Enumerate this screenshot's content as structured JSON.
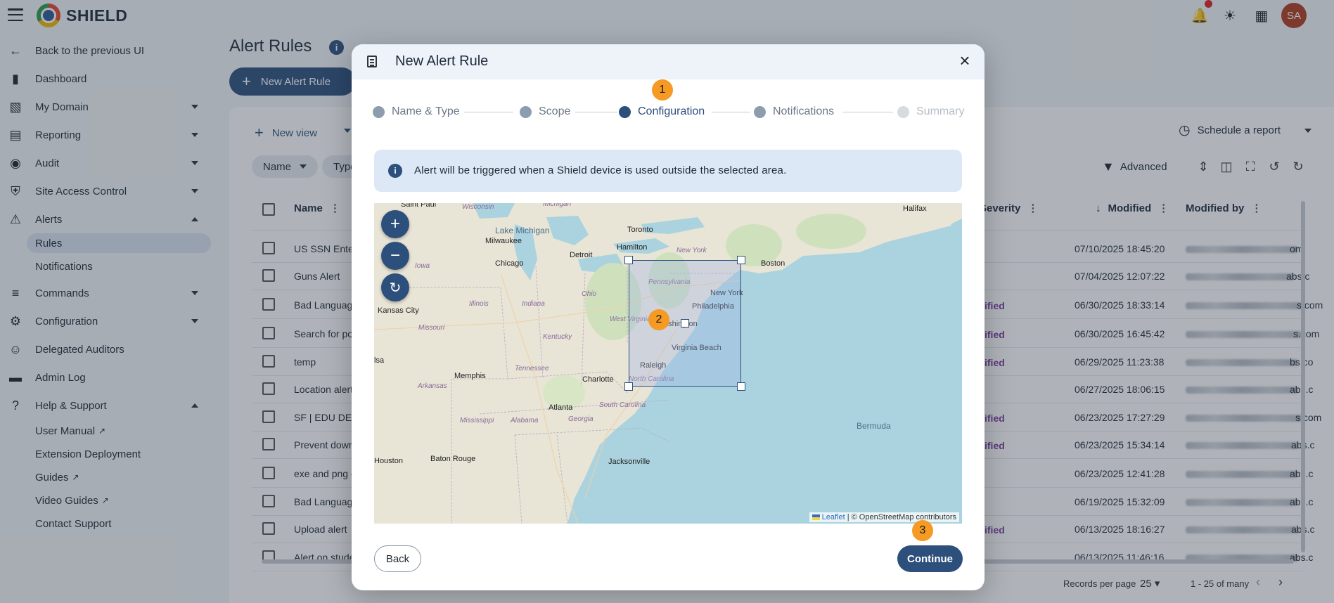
{
  "app": {
    "brand": "SHIELD",
    "avatar_initials": "SA"
  },
  "sidebar": {
    "back": "Back to the previous UI",
    "items": [
      {
        "label": "Dashboard",
        "icon": "bar-chart-icon"
      },
      {
        "label": "My Domain",
        "icon": "domain-icon"
      },
      {
        "label": "Reporting",
        "icon": "report-icon"
      },
      {
        "label": "Audit",
        "icon": "audit-icon"
      },
      {
        "label": "Site Access Control",
        "icon": "shield-icon"
      },
      {
        "label": "Alerts",
        "icon": "alert-shield-icon"
      },
      {
        "label": "Commands",
        "icon": "commands-icon"
      },
      {
        "label": "Configuration",
        "icon": "gear-icon"
      },
      {
        "label": "Delegated Auditors",
        "icon": "people-icon"
      },
      {
        "label": "Admin Log",
        "icon": "log-icon"
      },
      {
        "label": "Help & Support",
        "icon": "help-icon"
      }
    ],
    "alerts_sub": [
      "Rules",
      "Notifications"
    ],
    "help_sub": [
      "User Manual",
      "Extension Deployment",
      "Guides",
      "Video Guides",
      "Contact Support"
    ]
  },
  "page": {
    "title": "Alert Rules",
    "new_rule": "New Alert Rule",
    "new_view": "New view",
    "schedule": "Schedule a report",
    "advanced": "Advanced",
    "chips": [
      "Name",
      "Type"
    ],
    "columns": {
      "name": "Name",
      "severity": "Severity",
      "modified": "Modified",
      "modified_by": "Modified by"
    },
    "rows": [
      {
        "name": "US SSN Enter",
        "tag": "",
        "modified": "07/10/2025 18:45:20",
        "by_suffix": "om"
      },
      {
        "name": "Guns Alert",
        "tag": "",
        "modified": "07/04/2025 12:07:22",
        "by_suffix": "abs.c"
      },
      {
        "name": "Bad Language",
        "tag": "ified",
        "modified": "06/30/2025 18:33:14",
        "by_suffix": "s.com"
      },
      {
        "name": "Search for po",
        "tag": "ified",
        "modified": "06/30/2025 16:45:42",
        "by_suffix": "s.com"
      },
      {
        "name": "temp",
        "tag": "ified",
        "modified": "06/29/2025 11:23:38",
        "by_suffix": "bs.co"
      },
      {
        "name": "Location alert",
        "tag": "",
        "modified": "06/27/2025 18:06:15",
        "by_suffix": "abs.c"
      },
      {
        "name": "SF | EDU DEM",
        "tag": "ified",
        "modified": "06/23/2025 17:27:29",
        "by_suffix": "s.com"
      },
      {
        "name": "Prevent down",
        "tag": "ified",
        "modified": "06/23/2025 15:34:14",
        "by_suffix": "abs.c"
      },
      {
        "name": "exe and png c",
        "tag": "",
        "modified": "06/23/2025 12:41:28",
        "by_suffix": "abs.c"
      },
      {
        "name": "Bad Language",
        "tag": "",
        "modified": "06/19/2025 15:32:09",
        "by_suffix": "abs.c"
      },
      {
        "name": "Upload alert",
        "tag": "ified",
        "modified": "06/13/2025 18:16:27",
        "by_suffix": "abs.c"
      },
      {
        "name": "Alert on stude",
        "tag": "",
        "modified": "06/13/2025 11:46:16",
        "by_suffix": "abs.c"
      }
    ],
    "records_per_page_label": "Records per page",
    "records_per_page": "25",
    "range": "1 - 25 of many"
  },
  "modal": {
    "title": "New Alert Rule",
    "steps": [
      {
        "label": "Name & Type",
        "state": "done"
      },
      {
        "label": "Scope",
        "state": "done"
      },
      {
        "label": "Configuration",
        "state": "active"
      },
      {
        "label": "Notifications",
        "state": "done"
      },
      {
        "label": "Summary",
        "state": "pending"
      }
    ],
    "info": "Alert will be triggered when a Shield device is used outside the selected area.",
    "back": "Back",
    "continue": "Continue",
    "badges": [
      "1",
      "2",
      "3"
    ],
    "map": {
      "attribution_leaflet": "Leaflet",
      "attribution_rest": "| © OpenStreetMap contributors",
      "labels": {
        "saint_paul": "Saint Paul",
        "wisconsin": "Wisconsin",
        "michigan": "Michigan",
        "halifax": "Halifax",
        "toronto": "Toronto",
        "lake_michigan": "Lake Michigan",
        "milwaukee": "Milwaukee",
        "hamilton": "Hamilton",
        "new_york_state": "New York",
        "detroit": "Detroit",
        "iowa": "Iowa",
        "chicago": "Chicago",
        "boston": "Boston",
        "pennsylvania": "Pennsylvania",
        "new_york": "New York",
        "ohio": "Ohio",
        "philadelphia": "Philadelphia",
        "kansas_city": "Kansas City",
        "illinois": "Illinois",
        "indiana": "Indiana",
        "west_virginia": "West Virginia",
        "washington": "Washington",
        "missouri": "Missouri",
        "kentucky": "Kentucky",
        "virginia_beach": "Virginia Beach",
        "tulsa": "lsa",
        "raleigh": "Raleigh",
        "tennessee": "Tennessee",
        "memphis": "Memphis",
        "charlotte": "Charlotte",
        "north_carolina": "North Carolina",
        "arkansas": "Arkansas",
        "atlanta": "Atlanta",
        "south_carolina": "South Carolina",
        "mississippi": "Mississippi",
        "alabama": "Alabama",
        "georgia": "Georgia",
        "bermuda": "Bermuda",
        "houston": "Houston",
        "baton_rouge": "Baton Rouge",
        "jacksonville": "Jacksonville"
      }
    }
  },
  "colors": {
    "primary": "#2c4f7c",
    "badge": "#f59a23",
    "water": "#aad3df",
    "land": "#e8e4d6"
  }
}
